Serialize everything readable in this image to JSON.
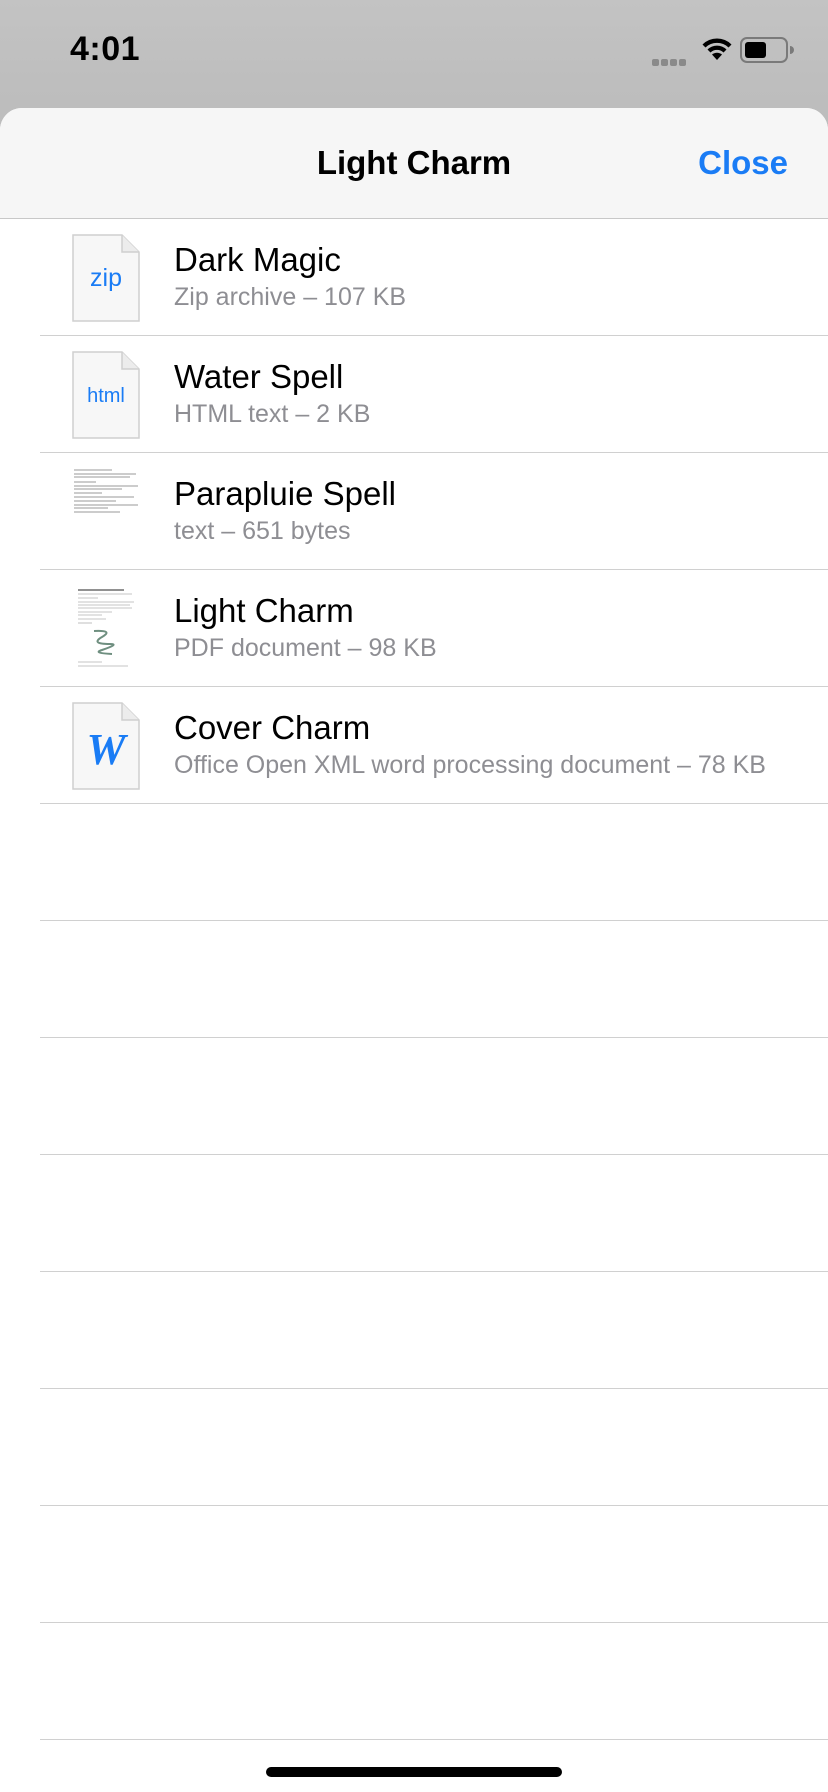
{
  "status_bar": {
    "time": "4:01"
  },
  "nav": {
    "title": "Light Charm",
    "close_label": "Close"
  },
  "files": [
    {
      "name": "Dark Magic",
      "meta": "Zip archive – 107 KB",
      "icon_type": "zip",
      "icon_label": "zip"
    },
    {
      "name": "Water Spell",
      "meta": "HTML text – 2 KB",
      "icon_type": "html",
      "icon_label": "html"
    },
    {
      "name": "Parapluie Spell",
      "meta": "text – 651 bytes",
      "icon_type": "text-thumbnail"
    },
    {
      "name": "Light Charm",
      "meta": "PDF document – 98 KB",
      "icon_type": "pdf-thumbnail"
    },
    {
      "name": "Cover Charm",
      "meta": "Office Open XML word processing document – 78 KB",
      "icon_type": "word",
      "icon_label": "W"
    }
  ],
  "colors": {
    "accent": "#1a7cf5",
    "secondary_text": "#8e8e93"
  }
}
